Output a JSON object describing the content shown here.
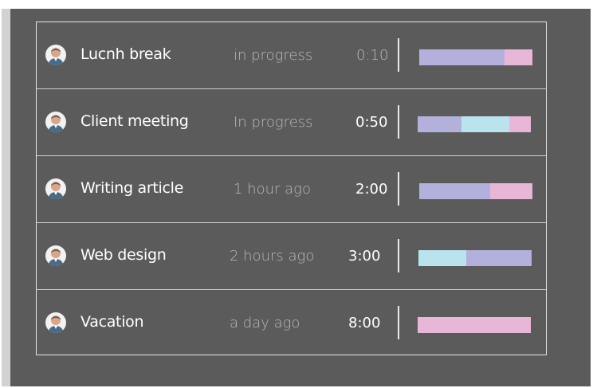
{
  "colors": {
    "background": "#5b5b5b",
    "text_primary": "#ffffff",
    "text_secondary": "#b8b8b8",
    "lavender": "#b3b1dc",
    "pink": "#e8b7d8",
    "cyan": "#bbe3ee"
  },
  "tasks": [
    {
      "title": "Lucnh break",
      "status": "in progress",
      "duration": "0:10",
      "segments": [
        {
          "color": "#b3b1dc",
          "fraction": 0.75
        },
        {
          "color": "#e8b7d8",
          "fraction": 0.25
        }
      ]
    },
    {
      "title": "Client meeting",
      "status": "In progress",
      "duration": "0:50",
      "segments": [
        {
          "color": "#b3b1dc",
          "fraction": 0.39
        },
        {
          "color": "#bbe3ee",
          "fraction": 0.42
        },
        {
          "color": "#e8b7d8",
          "fraction": 0.19
        }
      ]
    },
    {
      "title": "Writing article",
      "status": "1 hour ago",
      "duration": "2:00",
      "segments": [
        {
          "color": "#b3b1dc",
          "fraction": 0.63
        },
        {
          "color": "#e8b7d8",
          "fraction": 0.37
        }
      ]
    },
    {
      "title": "Web design",
      "status": "2 hours ago",
      "duration": "3:00",
      "segments": [
        {
          "color": "#bbe3ee",
          "fraction": 0.42
        },
        {
          "color": "#b3b1dc",
          "fraction": 0.58
        }
      ]
    },
    {
      "title": "Vacation",
      "status": "a day ago",
      "duration": "8:00",
      "segments": [
        {
          "color": "#e8b7d8",
          "fraction": 1.0
        }
      ]
    }
  ]
}
